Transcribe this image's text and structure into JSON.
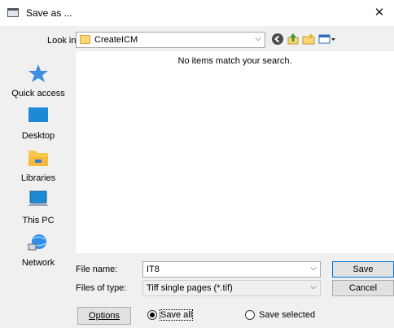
{
  "window": {
    "title": "Save as ...",
    "close_glyph": "✕"
  },
  "lookin": {
    "label": "Look in:",
    "value": "CreateICM",
    "arrow": "⌵"
  },
  "toolbar": [
    {
      "name": "back-icon"
    },
    {
      "name": "up-folder-icon"
    },
    {
      "name": "new-folder-icon"
    },
    {
      "name": "view-menu-icon"
    }
  ],
  "places": [
    {
      "label": "Quick access",
      "icon": "star-icon"
    },
    {
      "label": "Desktop",
      "icon": "desktop-icon"
    },
    {
      "label": "Libraries",
      "icon": "libraries-icon"
    },
    {
      "label": "This PC",
      "icon": "computer-icon"
    },
    {
      "label": "Network",
      "icon": "network-icon"
    }
  ],
  "filelist": {
    "empty_message": "No items match your search."
  },
  "filename": {
    "label": "File name:",
    "value": "IT8"
  },
  "filetype": {
    "label": "Files of type:",
    "value": "Tiff single pages (*.tif)"
  },
  "buttons": {
    "save": "Save",
    "cancel": "Cancel",
    "options": "Options"
  },
  "radios": {
    "save_all": "Save all",
    "save_selected": "Save selected",
    "selected": "save_all"
  },
  "colors": {
    "folder": "#f8d775",
    "accent": "#0078d7"
  }
}
